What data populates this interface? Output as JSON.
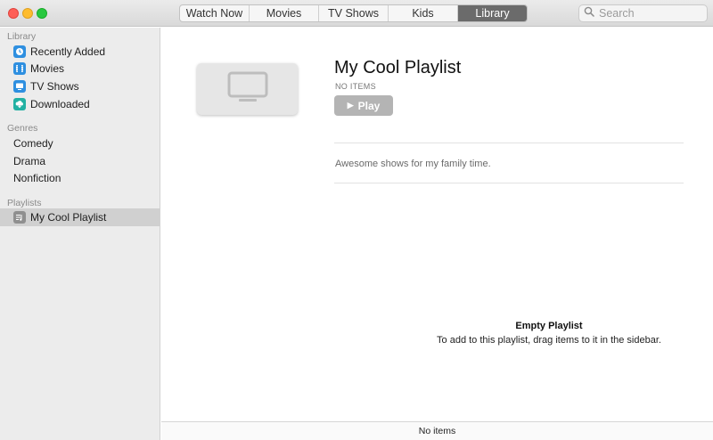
{
  "toolbar": {
    "tabs": [
      {
        "label": "Watch Now"
      },
      {
        "label": "Movies"
      },
      {
        "label": "TV Shows"
      },
      {
        "label": "Kids"
      },
      {
        "label": "Library",
        "active": true
      }
    ],
    "search": {
      "placeholder": "Search",
      "value": ""
    }
  },
  "sidebar": {
    "library_header": "Library",
    "library_items": [
      {
        "label": "Recently Added",
        "icon": "clock-icon"
      },
      {
        "label": "Movies",
        "icon": "film-icon"
      },
      {
        "label": "TV Shows",
        "icon": "tv-icon"
      },
      {
        "label": "Downloaded",
        "icon": "cloud-download-icon"
      }
    ],
    "genres_header": "Genres",
    "genre_items": [
      {
        "label": "Comedy"
      },
      {
        "label": "Drama"
      },
      {
        "label": "Nonfiction"
      }
    ],
    "playlists_header": "Playlists",
    "playlist_items": [
      {
        "label": "My Cool Playlist",
        "icon": "playlist-icon",
        "selected": true
      }
    ]
  },
  "main": {
    "playlist_title": "My Cool Playlist",
    "item_count": "NO ITEMS",
    "play_label": "Play",
    "description": "Awesome shows for my family time.",
    "empty_title": "Empty Playlist",
    "empty_message": "To add to this playlist, drag items to it in the sidebar.",
    "status": "No items"
  },
  "colors": {
    "accent_active_tab": "#6b6b6b",
    "sidebar_bg": "#ececec",
    "play_button_disabled": "#b4b4b4",
    "icon_blue": "#2e8fe0",
    "icon_teal": "#22b1a3"
  }
}
